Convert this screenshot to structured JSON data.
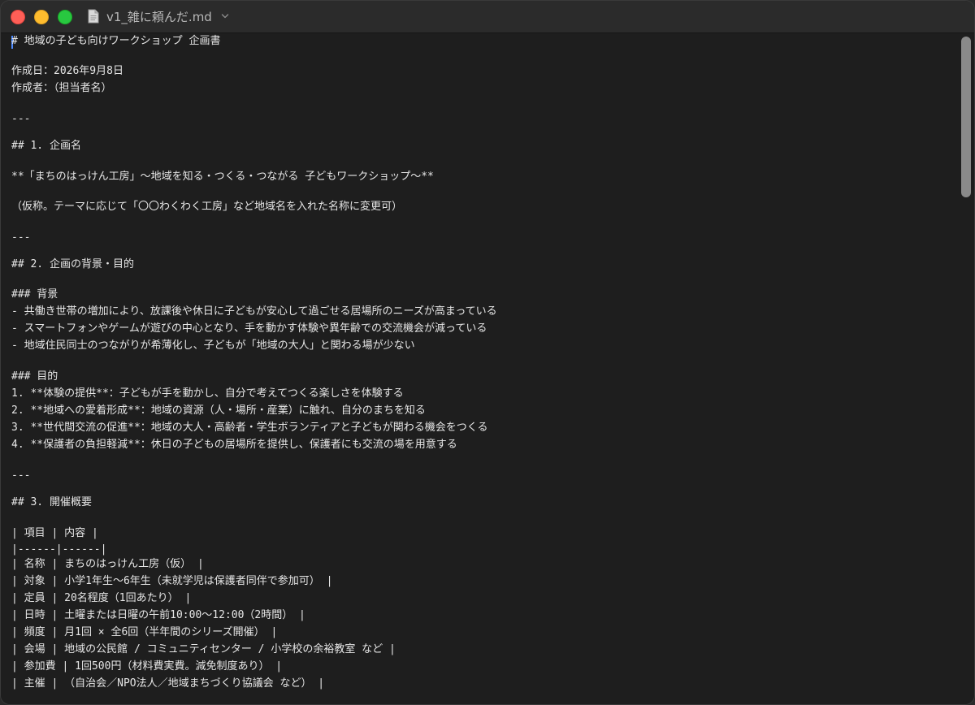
{
  "window": {
    "title": "v1_雑に頼んだ.md"
  },
  "editor": {
    "lines": [
      "# 地域の子ども向けワークショップ 企画書",
      "作成日：2026年9月8日",
      "作成者：（担当者名）",
      "---",
      "## 1. 企画名",
      "**「まちのはっけん工房」〜地域を知る・つくる・つながる 子どもワークショップ〜**",
      "（仮称。テーマに応じて「〇〇わくわく工房」など地域名を入れた名称に変更可）",
      "---",
      "## 2. 企画の背景・目的",
      "### 背景",
      "- 共働き世帯の増加により、放課後や休日に子どもが安心して過ごせる居場所のニーズが高まっている",
      "- スマートフォンやゲームが遊びの中心となり、手を動かす体験や異年齢での交流機会が減っている",
      "- 地域住民同士のつながりが希薄化し、子どもが「地域の大人」と関わる場が少ない",
      "### 目的",
      "1. **体験の提供**：子どもが手を動かし、自分で考えてつくる楽しさを体験する",
      "2. **地域への愛着形成**：地域の資源（人・場所・産業）に触れ、自分のまちを知る",
      "3. **世代間交流の促進**：地域の大人・高齢者・学生ボランティアと子どもが関わる機会をつくる",
      "4. **保護者の負担軽減**：休日の子どもの居場所を提供し、保護者にも交流の場を用意する",
      "---",
      "## 3. 開催概要",
      "| 項目 | 内容 |",
      "|------|------|",
      "| 名称 | まちのはっけん工房（仮） |",
      "| 対象 | 小学1年生〜6年生（未就学児は保護者同伴で参加可） |",
      "| 定員 | 20名程度（1回あたり） |",
      "| 日時 | 土曜または日曜の午前10:00〜12:00（2時間） |",
      "| 頻度 | 月1回 × 全6回（半年間のシリーズ開催） |",
      "| 会場 | 地域の公民館 / コミュニティセンター / 小学校の余裕教室 など |",
      "| 参加費 | 1回500円（材料費実費。減免制度あり） |",
      "| 主催 | （自治会／NPO法人／地域まちづくり協議会 など） |"
    ]
  }
}
